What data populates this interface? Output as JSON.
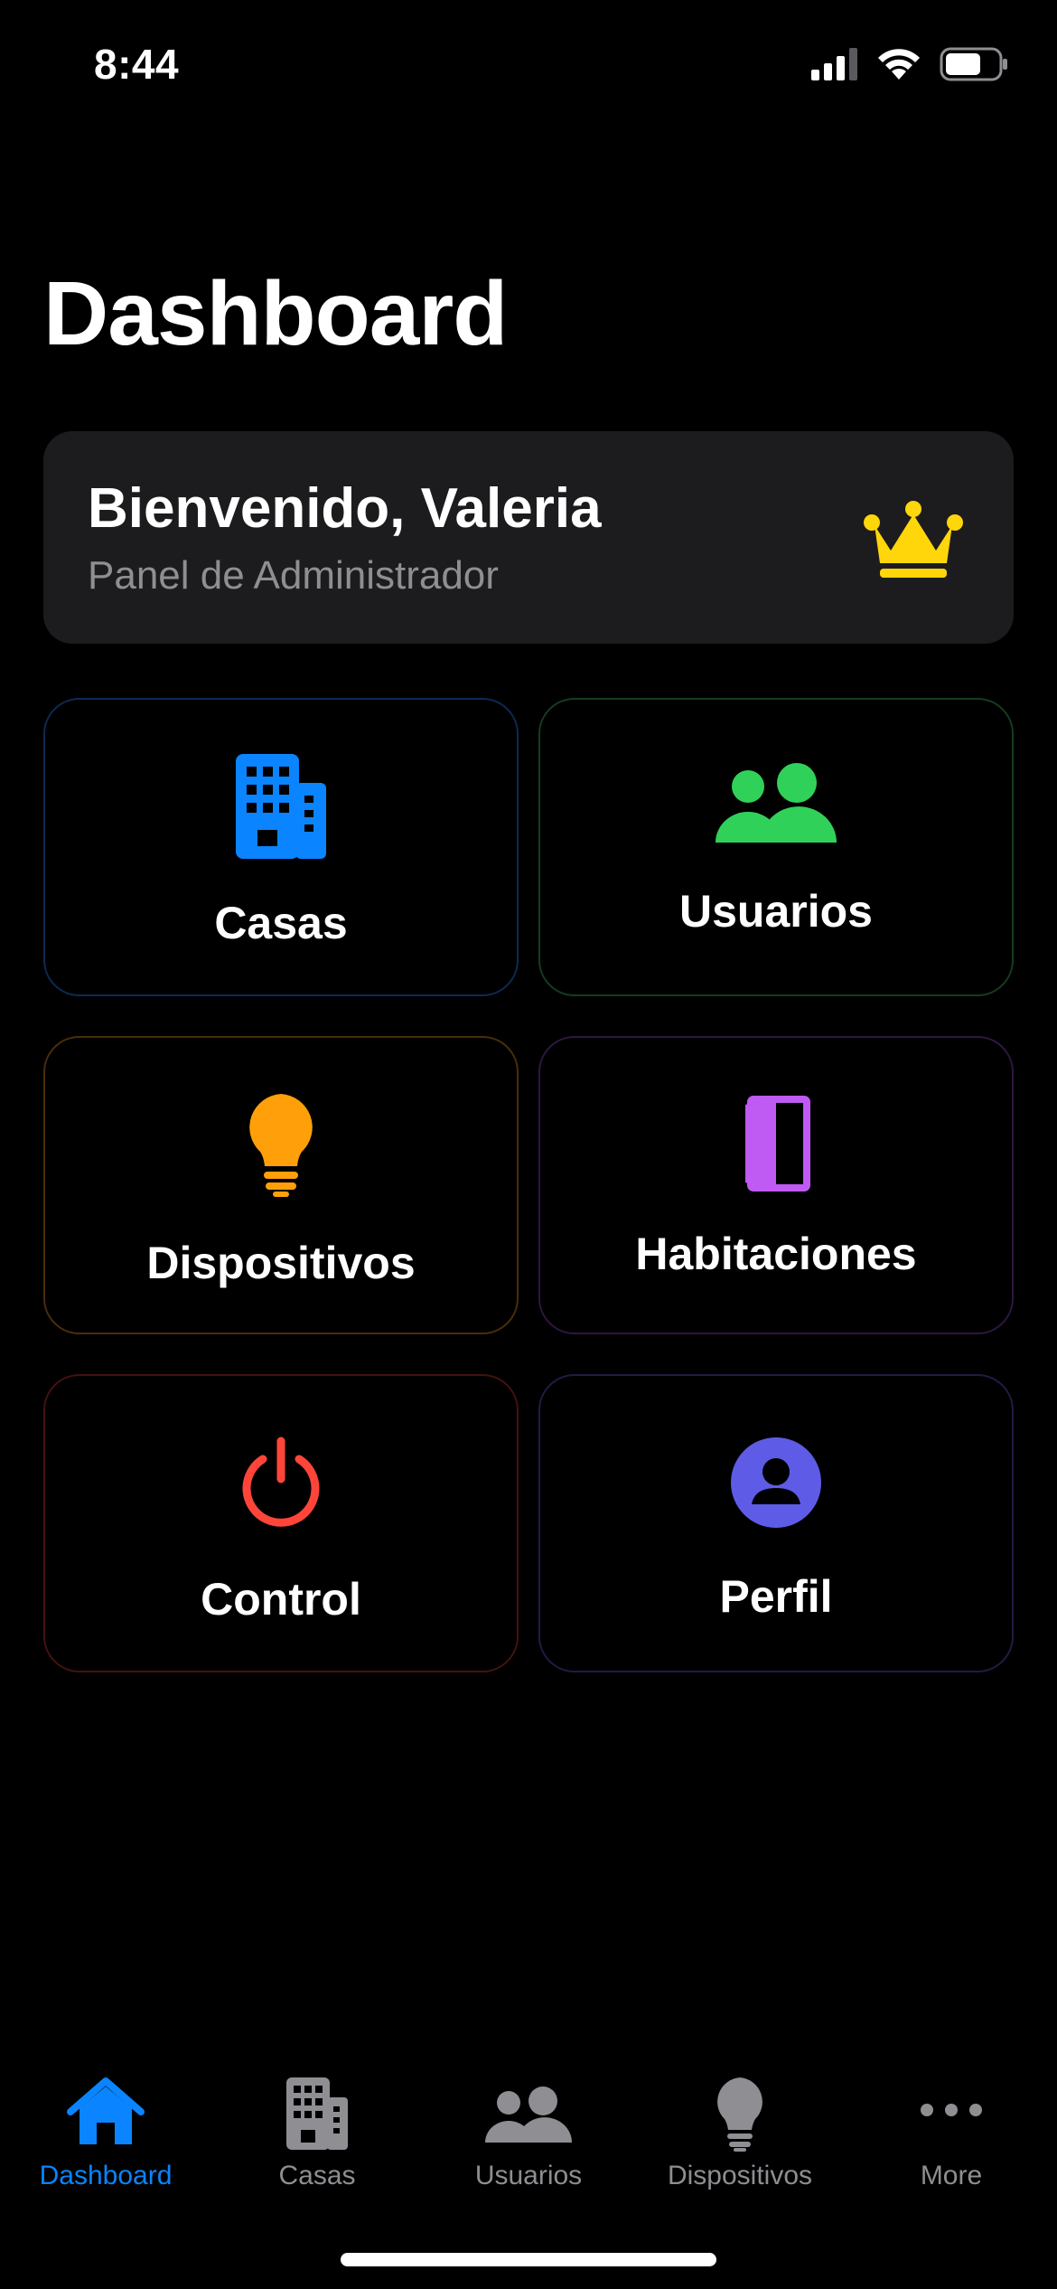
{
  "status": {
    "time": "8:44"
  },
  "title": "Dashboard",
  "welcome": {
    "title": "Bienvenido, Valeria",
    "subtitle": "Panel de Administrador",
    "icon": "crown-icon",
    "icon_color": "#ffd60a"
  },
  "tiles": [
    {
      "label": "Casas",
      "icon": "building-icon",
      "color": "#0a84ff"
    },
    {
      "label": "Usuarios",
      "icon": "users-icon",
      "color": "#30d158"
    },
    {
      "label": "Dispositivos",
      "icon": "lightbulb-icon",
      "color": "#ff9f0a"
    },
    {
      "label": "Habitaciones",
      "icon": "door-icon",
      "color": "#bf5af2"
    },
    {
      "label": "Control",
      "icon": "power-icon",
      "color": "#ff453a"
    },
    {
      "label": "Perfil",
      "icon": "profile-icon",
      "color": "#5e5ce6"
    }
  ],
  "tabbar": {
    "items": [
      {
        "label": "Dashboard",
        "icon": "house-icon",
        "active": true
      },
      {
        "label": "Casas",
        "icon": "building-icon",
        "active": false
      },
      {
        "label": "Usuarios",
        "icon": "users-icon",
        "active": false
      },
      {
        "label": "Dispositivos",
        "icon": "lightbulb-icon",
        "active": false
      },
      {
        "label": "More",
        "icon": "more-icon",
        "active": false
      }
    ],
    "active_color": "#0a84ff",
    "inactive_color": "#8e8e93"
  }
}
